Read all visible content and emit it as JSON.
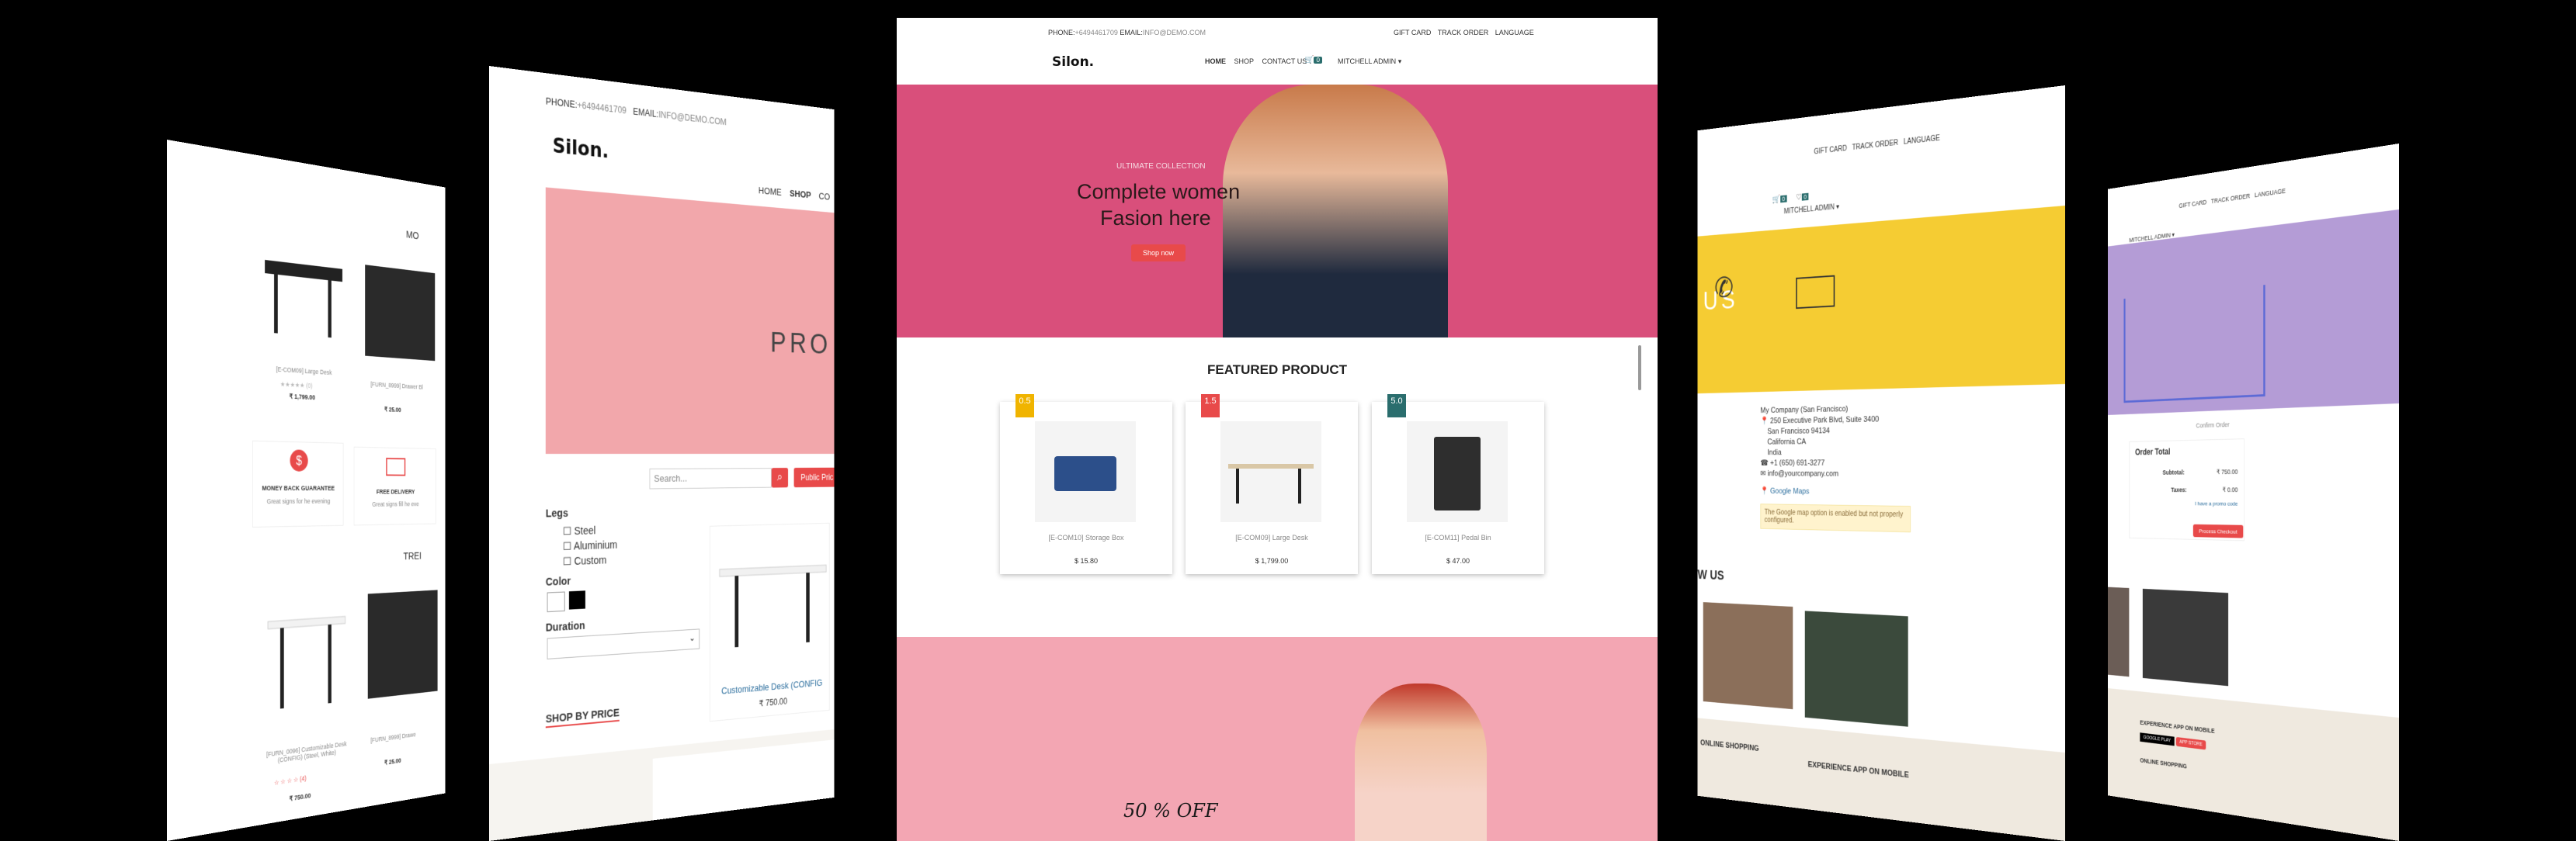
{
  "center": {
    "topbar": {
      "phone_label": "PHONE:",
      "phone": "+6494461709",
      "email_label": "EMAIL:",
      "email": "INFO@DEMO.COM",
      "links": [
        "GIFT CARD",
        "TRACK ORDER",
        "LANGUAGE"
      ]
    },
    "logo": "Silon.",
    "nav": [
      "HOME",
      "SHOP",
      "CONTACT US"
    ],
    "cart_count": "0",
    "user": "MITCHELL ADMIN",
    "hero": {
      "eyebrow": "ULTIMATE COLLECTION",
      "title_line1": "Complete women",
      "title_line2": "Fasion here",
      "button": "Shop now"
    },
    "featured_title": "FEATURED PRODUCT",
    "products": [
      {
        "badge": "0.5",
        "name": "[E-COM10] Storage Box",
        "price": "$ 15.80",
        "badge_color": "#f0b400"
      },
      {
        "badge": "1.5",
        "name": "[E-COM09] Large Desk",
        "price": "$ 1,799.00",
        "badge_color": "#e84a4a"
      },
      {
        "badge": "5.0",
        "name": "[E-COM11] Pedal Bin",
        "price": "$ 47.00",
        "badge_color": "#2a6d6d"
      }
    ],
    "promo": "50 % OFF"
  },
  "left1": {
    "heading": "MO",
    "products": [
      {
        "name": "[E-COM09] Large Desk",
        "price": "₹ 1,799.00",
        "rating": "(0)"
      },
      {
        "name": "[FURN_8999] Drawer Bl",
        "price": "₹ 25.00",
        "rating": "(0)"
      }
    ],
    "features": [
      {
        "title": "MONEY BACK GUARANTEE",
        "desc": "Great signs for he evening"
      },
      {
        "title": "FREE DELIVERY",
        "desc": "Great signs fill he eve"
      }
    ],
    "trend_heading": "TREI",
    "products2": [
      {
        "name": "[FURN_0096] Customizable Desk (CONFIG) (Steel, White)",
        "price": "₹ 750.00",
        "rating": "(4)"
      },
      {
        "name": "[FURN_8999] Drawe",
        "price": "₹ 25.00",
        "rating": "(0)"
      }
    ]
  },
  "left2": {
    "phone_label": "PHONE:",
    "phone": "+6494461709",
    "email_label": "EMAIL:",
    "email": "INFO@DEMO.COM",
    "logo": "Silon.",
    "nav": [
      "HOME",
      "SHOP",
      "CO"
    ],
    "banner_text": "PRO",
    "search_placeholder": "Search...",
    "filter_button": "Public Pric",
    "legs_title": "Legs",
    "legs": [
      "Steel",
      "Aluminium",
      "Custom"
    ],
    "color_title": "Color",
    "duration_title": "Duration",
    "shop_by_price": "SHOP BY PRICE",
    "product_name": "Customizable Desk (CONFIG",
    "product_price": "₹ 750.00"
  },
  "right1": {
    "links": [
      "GIFT CARD",
      "TRACK ORDER",
      "LANGUAGE"
    ],
    "cart_count": "0",
    "wish_count": "0",
    "user": "MITCHELL ADMIN",
    "banner_text": "US",
    "address": [
      "My Company (San Francisco)",
      "250 Executive Park Blvd, Suite 3400",
      "San Francisco 94134",
      "California CA",
      "India",
      "+1 (650) 691-3277",
      "info@yourcompany.com"
    ],
    "maps_link": "Google Maps",
    "maps_warning": "The Google map option is enabled but not properly configured.",
    "follow": "W US",
    "online": "ONLINE SHOPPING",
    "app": "EXPERIENCE APP ON MOBILE"
  },
  "right2": {
    "links": [
      "GIFT CARD",
      "TRACK ORDER",
      "LANGUAGE"
    ],
    "user": "MITCHELL ADMIN",
    "step": "Confirm Order",
    "order_total": "Order Total",
    "subtotal_label": "Subtotal:",
    "subtotal": "₹ 750.00",
    "taxes_label": "Taxes:",
    "taxes": "₹ 0.00",
    "promo_link": "I have a promo code",
    "checkout": "Process Checkout",
    "app": "EXPERIENCE APP ON MOBILE",
    "online": "ONLINE SHOPPING",
    "app_buttons": [
      "GOOGLE PLAY",
      "APP STORE"
    ]
  },
  "colors": {
    "accent": "#e84a4a",
    "hero_pink": "#d94f7b",
    "yellow": "#f5cc33",
    "lavender": "#b49cd6",
    "teal": "#2a6d6d"
  }
}
